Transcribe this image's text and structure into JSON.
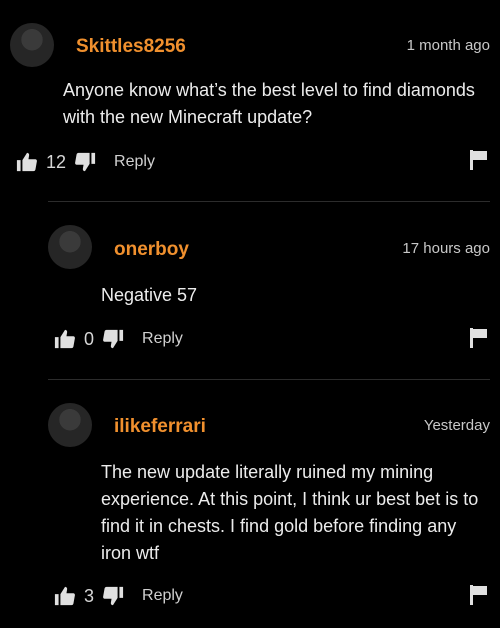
{
  "comments": [
    {
      "username": "Skittles8256",
      "time": "1 month ago",
      "text": "Anyone know what’s the best level to find diamonds with the new Minecraft update?",
      "likes": "12",
      "reply_label": "Reply"
    },
    {
      "username": "onerboy",
      "time": "17 hours ago",
      "text": "Negative 57",
      "likes": "0",
      "reply_label": "Reply"
    },
    {
      "username": "ilikeferrari",
      "time": "Yesterday",
      "text": "The new update literally ruined my mining experience. At this point, I think ur best bet is to find it in chests. I find gold before finding any iron wtf",
      "likes": "3",
      "reply_label": "Reply"
    }
  ],
  "colors": {
    "username": "#f0902e",
    "background": "#000000"
  },
  "icons": [
    "thumbs-up-icon",
    "thumbs-down-icon",
    "flag-icon",
    "avatar"
  ]
}
